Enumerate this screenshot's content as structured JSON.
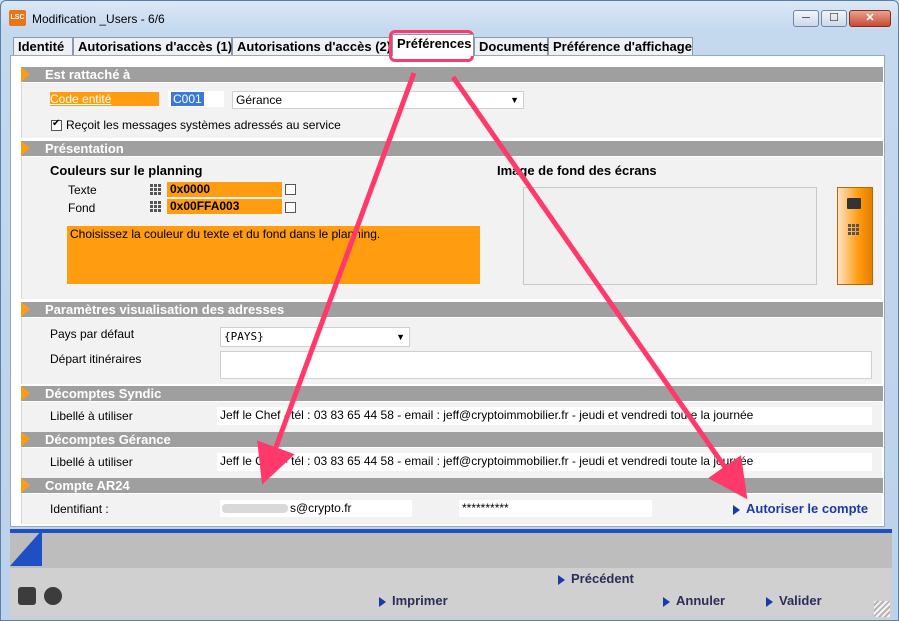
{
  "window": {
    "logo": "LSC",
    "title": "Modification _Users - 6/6",
    "minimize": "─",
    "maximize": "☐",
    "close": "✕"
  },
  "tabs": [
    {
      "label": "Identité"
    },
    {
      "label": "Autorisations d'accès (1)"
    },
    {
      "label": "Autorisations d'accès (2)"
    },
    {
      "label": "Préférences",
      "active": true
    },
    {
      "label": "Documents"
    },
    {
      "label": "Préférence d'affichage"
    }
  ],
  "rattache": {
    "heading": "Est rattaché à",
    "code_label": "Code entité",
    "code_value": "C001",
    "entity_value": "Gérance",
    "checkbox_label": "Reçoit les messages systèmes adressés au service",
    "checkbox_checked": true
  },
  "presentation": {
    "heading": "Présentation",
    "planning_title": "Couleurs sur le planning",
    "text_label": "Texte",
    "text_color": "0x0000",
    "fond_label": "Fond",
    "fond_color": "0x00FFA003",
    "help_text": "Choisissez la couleur du texte et du fond dans le planning.",
    "background_title": "Image de fond des écrans"
  },
  "adresses": {
    "heading": "Paramètres visualisation des adresses",
    "pays_label": "Pays par défaut",
    "pays_value": "{PAYS}",
    "depart_label": "Départ itinéraires",
    "depart_value": ""
  },
  "syndic": {
    "heading": "Décomptes Syndic",
    "label": "Libellé à utiliser",
    "value": "Jeff le Chef - tél : 03 83 65 44 58  - email : jeff@cryptoimmobilier.fr - jeudi et vendredi toute la journée"
  },
  "gerance": {
    "heading": "Décomptes Gérance",
    "label": "Libellé à utiliser",
    "value": "Jeff le Chef - tél : 03 83 65 44 58  - email : jeff@cryptoimmobilier.fr -  jeudi et vendredi toute la journée"
  },
  "ar24": {
    "heading": "Compte AR24",
    "id_label": "Identifiant :",
    "id_value": "s@crypto.fr",
    "password_value": "**********",
    "authorize_label": "Autoriser le compte"
  },
  "footer": {
    "previous": "Précédent",
    "print": "Imprimer",
    "cancel": "Annuler",
    "validate": "Valider"
  },
  "colors": {
    "accent_orange": "#ff9c10",
    "section_gray": "#9f9f9f",
    "annotation_pink": "#ff3a6a",
    "footer_blue": "#1f4fc4"
  }
}
